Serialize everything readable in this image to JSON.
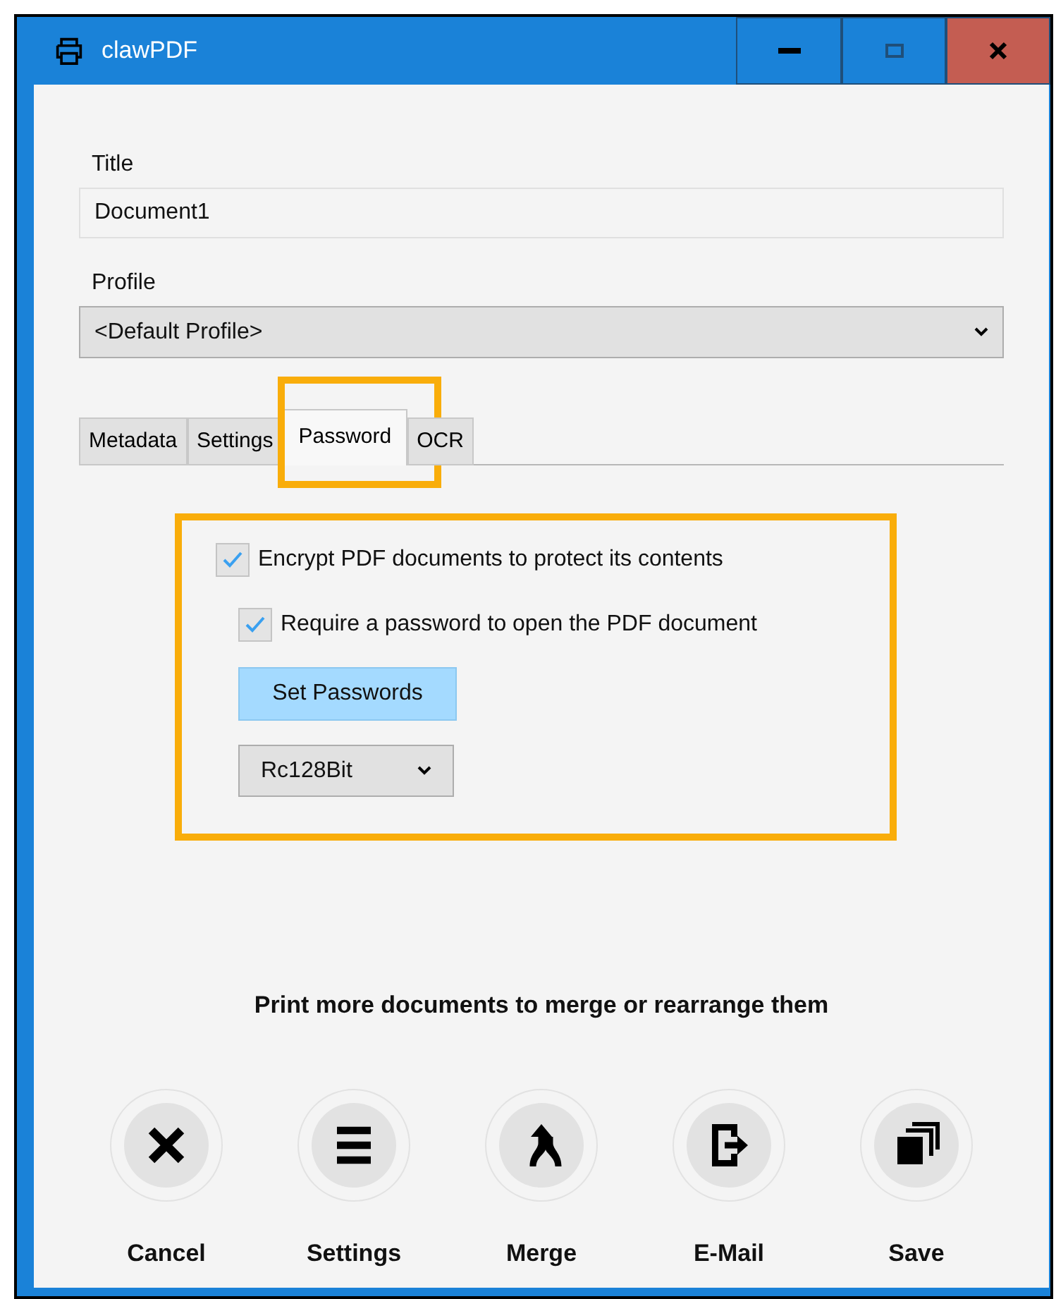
{
  "window": {
    "title": "clawPDF"
  },
  "title_field": {
    "label": "Title",
    "value": "Document1"
  },
  "profile": {
    "label": "Profile",
    "value": "<Default Profile>"
  },
  "tabs": [
    {
      "label": "Metadata",
      "selected": false,
      "highlighted": false
    },
    {
      "label": "Settings",
      "selected": false,
      "highlighted": false
    },
    {
      "label": "Password",
      "selected": true,
      "highlighted": true
    },
    {
      "label": "OCR",
      "selected": false,
      "highlighted": false
    }
  ],
  "password_panel": {
    "highlighted": true,
    "options": [
      {
        "label": "Encrypt PDF documents to protect its contents",
        "checked": true
      },
      {
        "label": "Require a password to open the PDF document",
        "checked": true
      }
    ],
    "set_passwords_button": "Set Passwords",
    "encryption": "Rc128Bit"
  },
  "hint": "Print more documents to merge or rearrange them",
  "actions": [
    {
      "kind": "cancel",
      "label": "Cancel"
    },
    {
      "kind": "settings",
      "label": "Settings"
    },
    {
      "kind": "merge",
      "label": "Merge"
    },
    {
      "kind": "email",
      "label": "E-Mail"
    },
    {
      "kind": "save",
      "label": "Save"
    }
  ]
}
